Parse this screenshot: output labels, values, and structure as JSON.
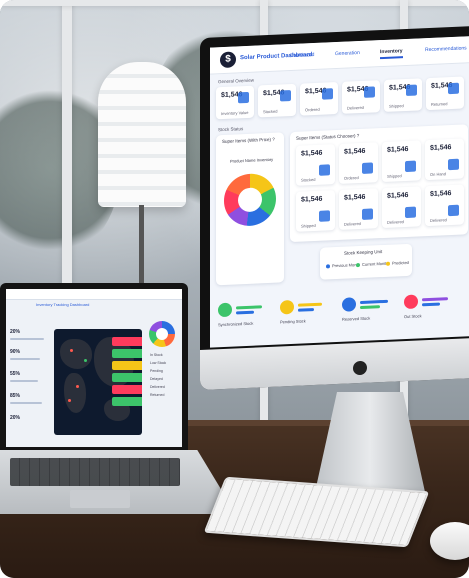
{
  "imac": {
    "brand": "Solar Product Dashboard",
    "logo_letter": "$",
    "tabs": [
      "Dashboard",
      "Generation",
      "Inventory",
      "Recommendations"
    ],
    "active_tab_index": 2,
    "section_general": "General Overview",
    "section_stock": "Stock Status",
    "cards_top": [
      {
        "value": "$1,546",
        "label": "Inventory Value"
      },
      {
        "value": "$1,546",
        "label": "Stocked"
      },
      {
        "value": "$1,546",
        "label": "Ordered"
      },
      {
        "value": "$1,546",
        "label": "Delivered"
      },
      {
        "value": "$1,546",
        "label": "Shipped"
      },
      {
        "value": "$1,546",
        "label": "Returned"
      }
    ],
    "panel_left_title": "Super Items (With Price) ?",
    "panel_left_chart_title": "Product Name Inventory",
    "panel_right_title": "Super Items (Status Chooser) ?",
    "cards_grid": [
      {
        "value": "$1,546",
        "label": "Stocked"
      },
      {
        "value": "$1,546",
        "label": "Ordered"
      },
      {
        "value": "$1,546",
        "label": "Shipped"
      },
      {
        "value": "$1,546",
        "label": "On Hand"
      },
      {
        "value": "$1,546",
        "label": "Shipped"
      },
      {
        "value": "$1,546",
        "label": "Delivered"
      },
      {
        "value": "$1,546",
        "label": "Delivered"
      },
      {
        "value": "$1,546",
        "label": "Delivered"
      }
    ],
    "stock_legend_title": "Stock Keeping Unit",
    "stock_legend": [
      "Previous Month",
      "Current Month",
      "Predicted"
    ],
    "kpis": [
      "Synchronized Stock",
      "Pending Stock",
      "Reserved Stock",
      "Out Stock"
    ],
    "colors": {
      "accent": "#2a6fe0",
      "brand": "#1a1f36",
      "green": "#3cc46a",
      "yellow": "#f5c518",
      "orange": "#ff6a3d",
      "purple": "#8f4fe0",
      "red": "#ff3b5c"
    }
  },
  "laptop": {
    "title": "Inventory Tracking Dashboard",
    "stats": [
      "20%",
      "90%",
      "55%",
      "85%",
      "20%"
    ],
    "legend": [
      "In Stock",
      "Low Stock",
      "Pending",
      "Delayed",
      "Delivered",
      "Returned"
    ]
  },
  "apple_logo": "apple-icon"
}
